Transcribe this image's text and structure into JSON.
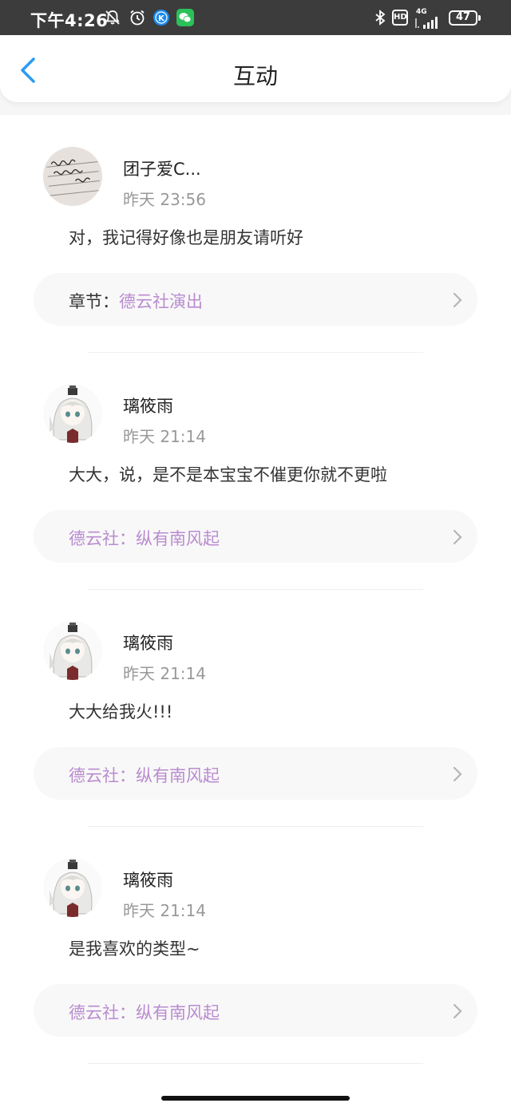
{
  "status_bar": {
    "time": "下午4:26",
    "network": "4G",
    "hd": "HD",
    "battery": "47",
    "icons": [
      "mute-bell-icon",
      "alarm-icon",
      "k-app-icon",
      "wechat-icon",
      "bluetooth-icon",
      "hd-icon",
      "signal-icon",
      "battery-icon"
    ]
  },
  "nav": {
    "title": "互动",
    "back_icon": "chevron-left-icon"
  },
  "colors": {
    "link_purple": "#b98bd0",
    "back_blue": "#2b9af3",
    "time_gray": "#999999"
  },
  "interactions": [
    {
      "user": "团子爱C...",
      "time": "昨天 23:56",
      "comment": "对，我记得好像也是朋友请听好",
      "chip_prefix": "章节：",
      "chip_text": "德云社演出",
      "avatar": "handwriting-avatar"
    },
    {
      "user": "璃筱雨",
      "time": "昨天 21:14",
      "comment": "大大，说，是不是本宝宝不催更你就不更啦",
      "chip_prefix": "",
      "chip_text": "德云社：纵有南风起",
      "avatar": "anime-girl-avatar"
    },
    {
      "user": "璃筱雨",
      "time": "昨天 21:14",
      "comment": "大大给我火!!!",
      "chip_prefix": "",
      "chip_text": "德云社：纵有南风起",
      "avatar": "anime-girl-avatar"
    },
    {
      "user": "璃筱雨",
      "time": "昨天 21:14",
      "comment": "是我喜欢的类型~",
      "chip_prefix": "",
      "chip_text": "德云社：纵有南风起",
      "avatar": "anime-girl-avatar"
    }
  ]
}
